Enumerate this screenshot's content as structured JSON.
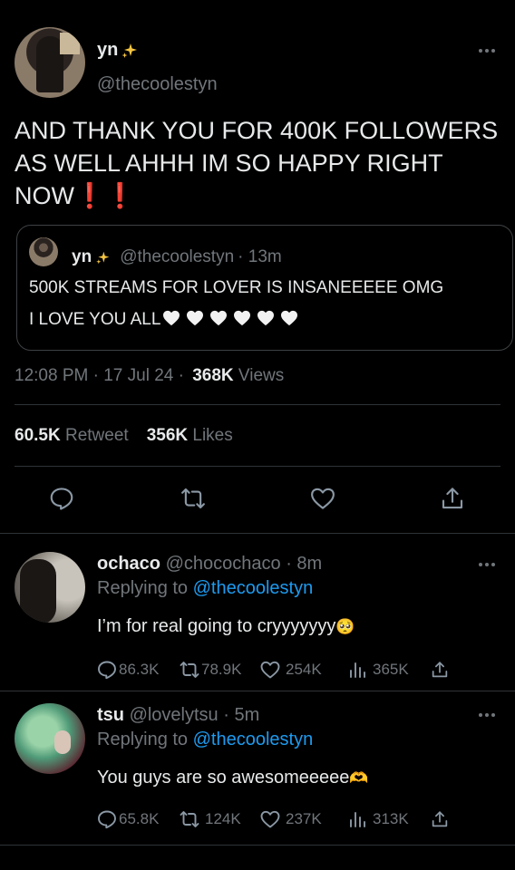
{
  "tweet": {
    "author_name": "yn",
    "author_handle": "@thecoolestyn",
    "text_lines": [
      "AND THANK YOU FOR 400K FOLLOWERS",
      "AS WELL AHHH IM SO HAPPY RIGHT",
      "NOW❗❗"
    ],
    "timestamp": "12:08 PM · 17 Jul 24 ·",
    "views_count": "368K",
    "views_label": "Views",
    "retweet_count": "60.5K",
    "retweet_label": "Retweet",
    "likes_count": "356K",
    "likes_label": "Likes"
  },
  "quote": {
    "author_name": "yn",
    "author_handle": "@thecoolestyn",
    "time": "· 13m",
    "line1": "500K STREAMS FOR LOVER IS INSANEEEEE OMG",
    "line2": "I LOVE YOU ALL"
  },
  "replies": [
    {
      "name": "ochaco",
      "handle": "@chocochaco",
      "time": "· 8m",
      "replying_label": "Replying to",
      "replying_to": "@thecoolestyn",
      "text": "I’m for real going to cryyyyyyy",
      "emoji": "🥺",
      "comments": "86.3K",
      "retweets": "78.9K",
      "likes": "254K",
      "views": "365K"
    },
    {
      "name": "tsu",
      "handle": "@lovelytsu",
      "time": "· 5m",
      "replying_label": "Replying to",
      "replying_to": "@thecoolestyn",
      "text": "You guys are so awesomeeeee",
      "emoji": "🫶",
      "comments": "65.8K",
      "retweets": "124K",
      "likes": "237K",
      "views": "313K"
    }
  ],
  "colors": {
    "background": "#000000",
    "text": "#e7e9ea",
    "muted": "#71767b",
    "link": "#1d9bf0",
    "border": "#2f3336",
    "sparkle": "#f5c542"
  },
  "icons": [
    "more-icon",
    "sparkle-icon",
    "reply-icon",
    "retweet-icon",
    "like-icon",
    "share-icon",
    "views-icon",
    "white-heart-icon"
  ]
}
